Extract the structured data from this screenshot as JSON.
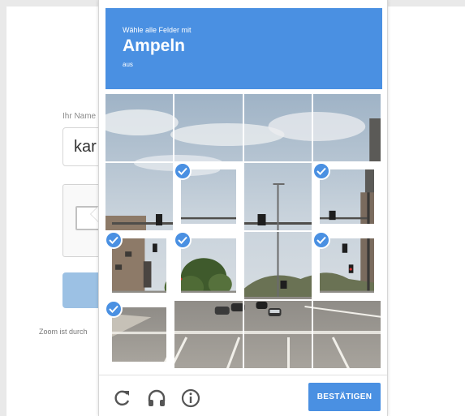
{
  "background_form": {
    "name_label": "Ihr Name",
    "name_value": "kar",
    "zoom_note": "Zoom ist durch"
  },
  "challenge": {
    "instruction_line1": "Wähle alle Felder mit",
    "keyword": "Ampeln",
    "instruction_line3": "aus",
    "selected_tiles": [
      5,
      7,
      8,
      9,
      11,
      12
    ],
    "grid_size": "4x4"
  },
  "footer": {
    "reload_icon": "reload-icon",
    "audio_icon": "headphones-icon",
    "info_icon": "info-icon",
    "verify_label": "BESTÄTIGEN"
  },
  "colors": {
    "accent": "#4a90e2",
    "check_color": "#4a90e2"
  }
}
